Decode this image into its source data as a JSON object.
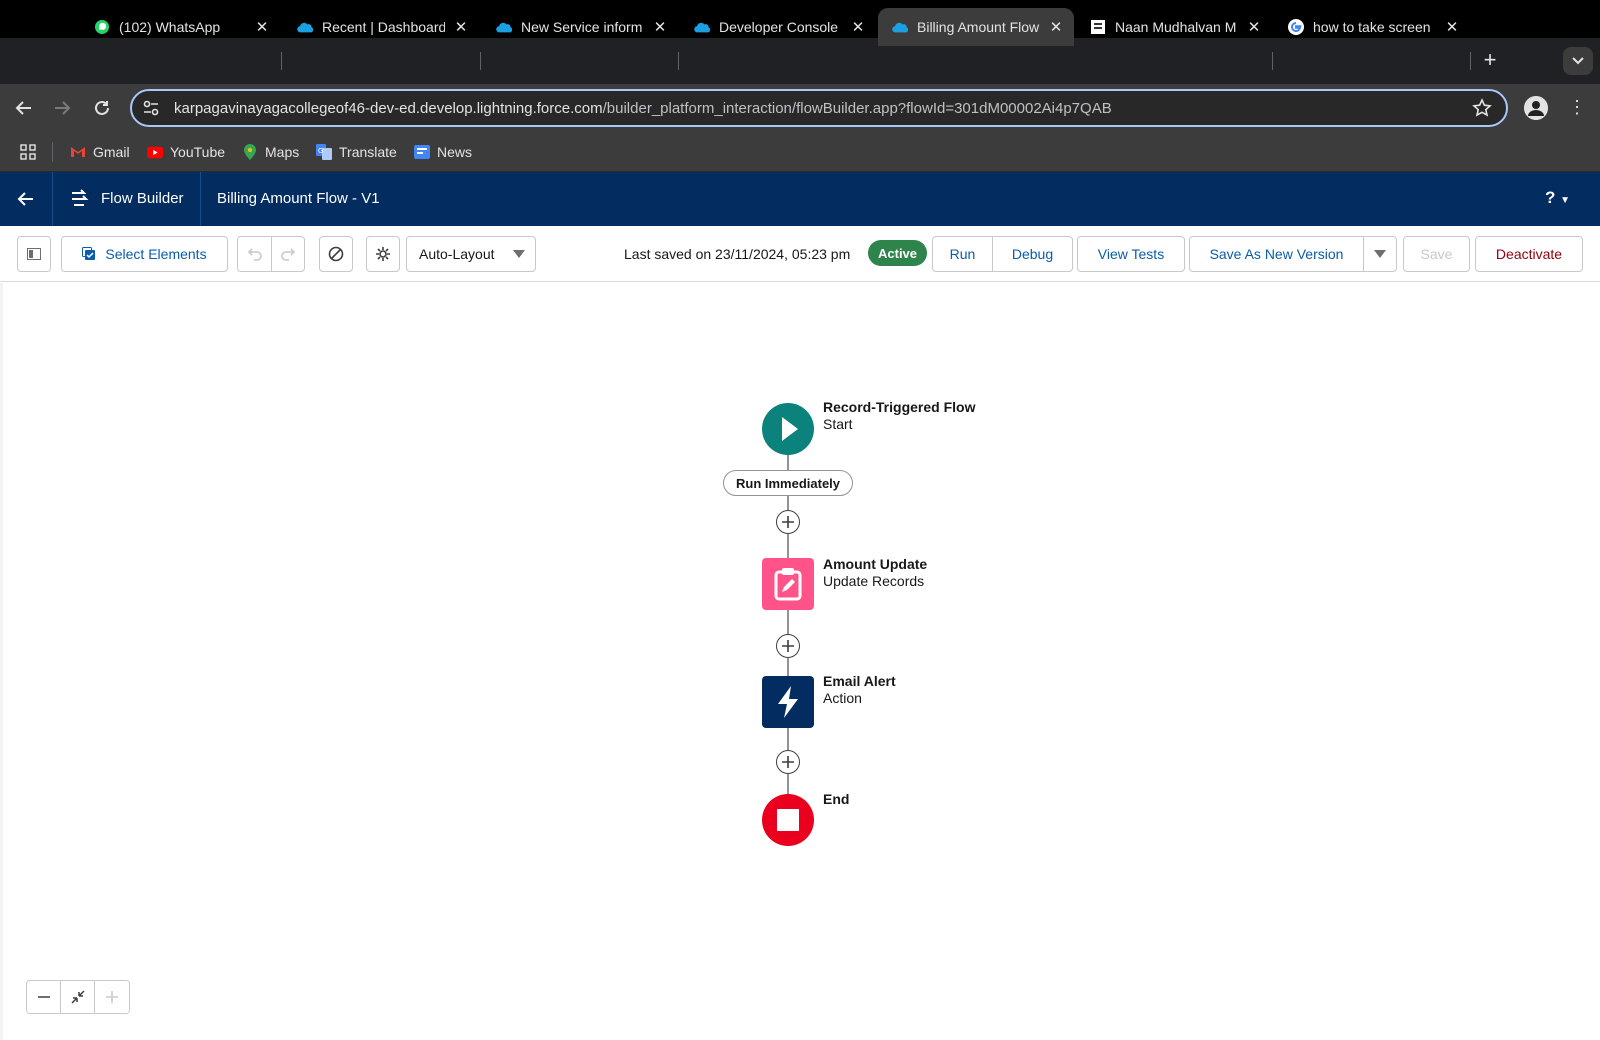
{
  "browser": {
    "tabs": [
      {
        "title": "(102) WhatsApp",
        "icon": "whatsapp-icon"
      },
      {
        "title": "Recent | Dashboard",
        "icon": "salesforce-cloud-icon"
      },
      {
        "title": "New Service inform",
        "icon": "salesforce-cloud-icon"
      },
      {
        "title": "Developer Console",
        "icon": "salesforce-cloud-icon"
      },
      {
        "title": "Billing Amount Flow",
        "icon": "salesforce-cloud-icon",
        "active": true
      },
      {
        "title": "Naan Mudhalvan M",
        "icon": "document-icon"
      },
      {
        "title": "how to take screen",
        "icon": "google-icon"
      }
    ],
    "url_host": "karpagavinayagacollegeof46-dev-ed.develop.lightning.force.com",
    "url_path": "/builder_platform_interaction/flowBuilder.app?flowId=301dM00002Ai4p7QAB",
    "bookmarks": [
      {
        "label": "Gmail",
        "icon": "gmail-icon"
      },
      {
        "label": "YouTube",
        "icon": "youtube-icon"
      },
      {
        "label": "Maps",
        "icon": "maps-icon"
      },
      {
        "label": "Translate",
        "icon": "translate-icon"
      },
      {
        "label": "News",
        "icon": "news-icon"
      }
    ]
  },
  "header": {
    "app_name": "Flow Builder",
    "flow_name": "Billing Amount Flow - V1",
    "help": "?"
  },
  "toolbar": {
    "select_elements": "Select Elements",
    "layout_mode": "Auto-Layout",
    "last_saved": "Last saved on 23/11/2024, 05:23 pm",
    "status": "Active",
    "run": "Run",
    "debug": "Debug",
    "view_tests": "View Tests",
    "save_as_new_version": "Save As New Version",
    "save": "Save",
    "deactivate": "Deactivate"
  },
  "flow": {
    "start": {
      "title": "Record-Triggered Flow",
      "subtitle": "Start"
    },
    "path_label": "Run Immediately",
    "nodes": [
      {
        "title": "Amount Update",
        "subtitle": "Update Records",
        "color": "#ff538a"
      },
      {
        "title": "Email Alert",
        "subtitle": "Action",
        "color": "#032d60"
      }
    ],
    "end": {
      "title": "End",
      "color": "#ea001e"
    },
    "start_color": "#0b827c"
  }
}
